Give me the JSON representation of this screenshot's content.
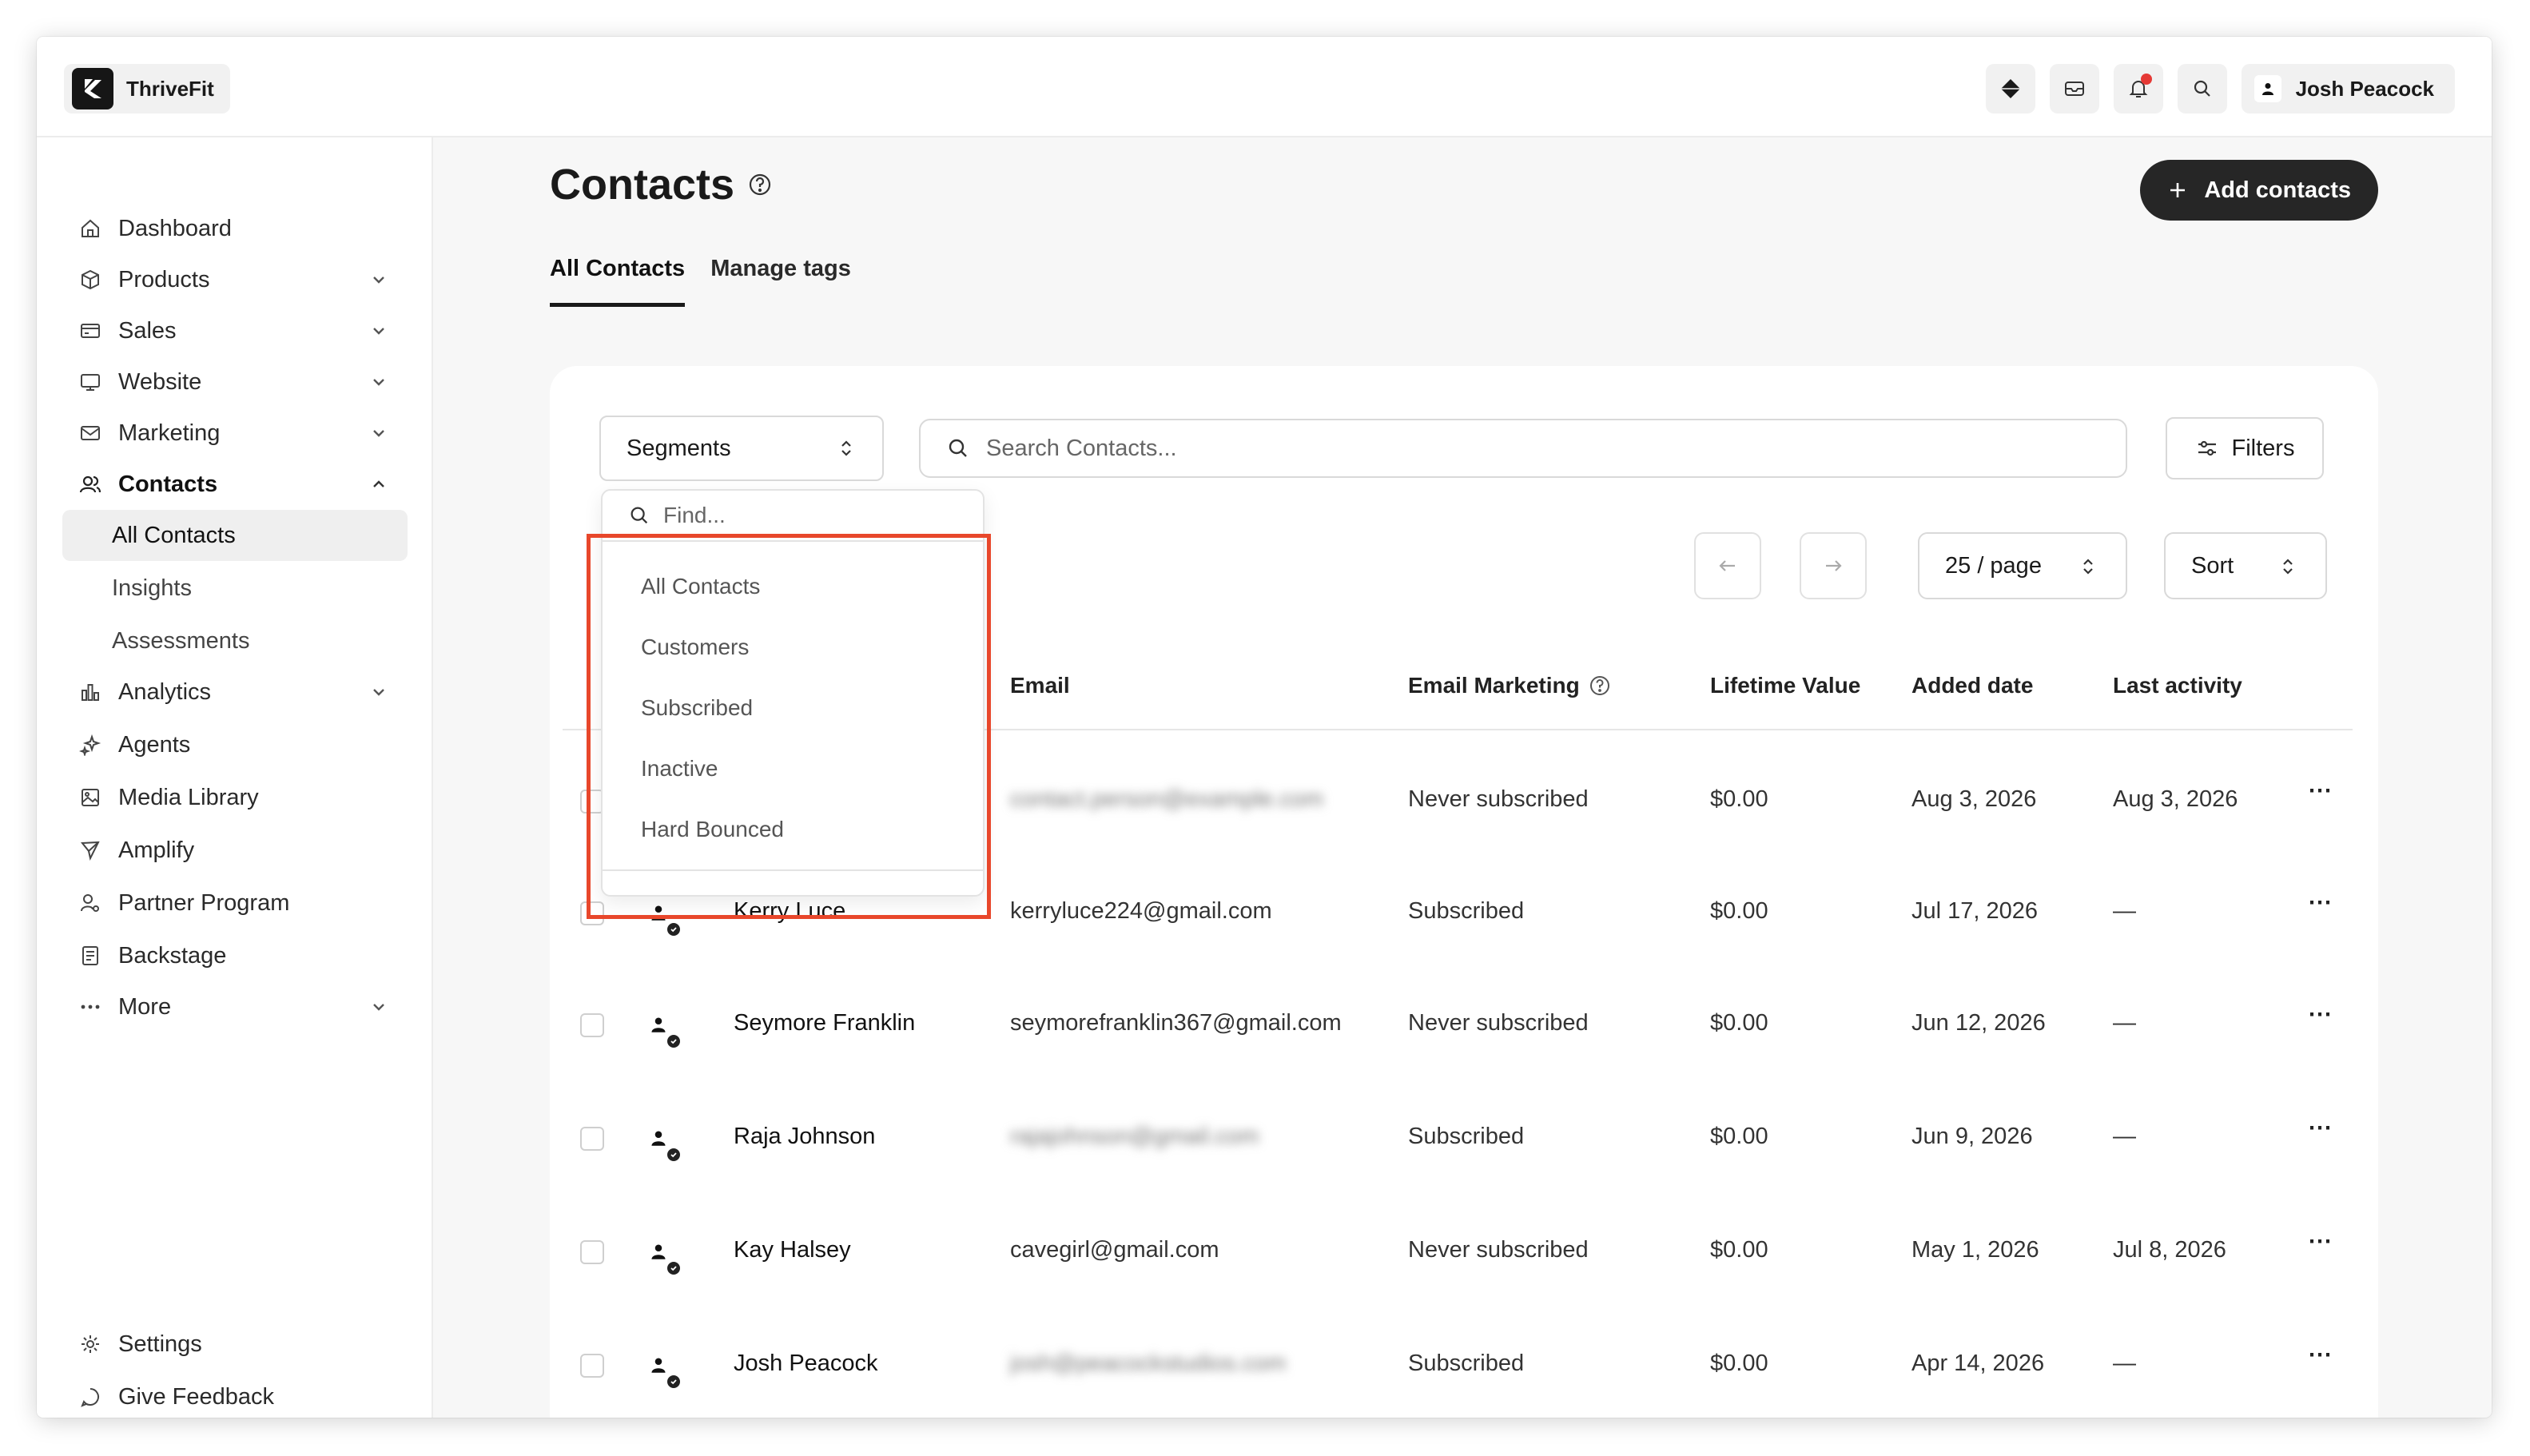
{
  "app": {
    "name": "ThriveFit"
  },
  "user": {
    "name": "Josh Peacock"
  },
  "topbar_icons": [
    "diamond-icon",
    "inbox-icon",
    "bell-icon",
    "search-icon"
  ],
  "sidebar": {
    "items": [
      {
        "label": "Dashboard",
        "icon": "home-icon"
      },
      {
        "label": "Products",
        "icon": "box-icon"
      },
      {
        "label": "Sales",
        "icon": "card-icon"
      },
      {
        "label": "Website",
        "icon": "monitor-icon"
      },
      {
        "label": "Marketing",
        "icon": "mail-icon"
      },
      {
        "label": "Contacts",
        "icon": "users-icon"
      },
      {
        "label": "All Contacts"
      },
      {
        "label": "Insights"
      },
      {
        "label": "Assessments"
      },
      {
        "label": "Analytics",
        "icon": "chart-icon"
      },
      {
        "label": "Agents",
        "icon": "sparkle-icon"
      },
      {
        "label": "Media Library",
        "icon": "image-icon"
      },
      {
        "label": "Amplify",
        "icon": "send-icon"
      },
      {
        "label": "Partner Program",
        "icon": "partner-icon"
      },
      {
        "label": "Backstage",
        "icon": "doc-icon"
      },
      {
        "label": "More",
        "icon": "dots-icon"
      }
    ],
    "bottom": [
      {
        "label": "Settings",
        "icon": "gear-icon"
      },
      {
        "label": "Give Feedback",
        "icon": "chat-icon"
      }
    ]
  },
  "page": {
    "title": "Contacts",
    "add_button": "Add contacts",
    "tabs": [
      {
        "label": "All Contacts"
      },
      {
        "label": "Manage tags"
      }
    ]
  },
  "toolbar": {
    "segments_label": "Segments",
    "search_placeholder": "Search Contacts...",
    "filters_label": "Filters",
    "per_page": "25 / page",
    "sort_label": "Sort"
  },
  "segments_dropdown": {
    "find_placeholder": "Find...",
    "options": [
      "All Contacts",
      "Customers",
      "Subscribed",
      "Inactive",
      "Hard Bounced"
    ]
  },
  "table": {
    "headers": {
      "email": "Email",
      "email_marketing": "Email Marketing",
      "lifetime_value": "Lifetime Value",
      "added_date": "Added date",
      "last_activity": "Last activity"
    },
    "rows": [
      {
        "name": "",
        "email": "contact.person@example.com",
        "email_blurred": true,
        "marketing": "Never subscribed",
        "ltv": "$0.00",
        "added": "Aug 3, 2026",
        "last": "Aug 3, 2026"
      },
      {
        "name": "Kerry Luce",
        "email": "kerryluce224@gmail.com",
        "email_blurred": false,
        "marketing": "Subscribed",
        "ltv": "$0.00",
        "added": "Jul 17, 2026",
        "last": "—"
      },
      {
        "name": "Seymore Franklin",
        "email": "seymorefranklin367@gmail.com",
        "email_blurred": false,
        "marketing": "Never subscribed",
        "ltv": "$0.00",
        "added": "Jun 12, 2026",
        "last": "—"
      },
      {
        "name": "Raja Johnson",
        "email": "rajajohnson@gmail.com",
        "email_blurred": true,
        "marketing": "Subscribed",
        "ltv": "$0.00",
        "added": "Jun 9, 2026",
        "last": "—"
      },
      {
        "name": "Kay Halsey",
        "email": "cavegirl@gmail.com",
        "email_blurred": false,
        "marketing": "Never subscribed",
        "ltv": "$0.00",
        "added": "May 1, 2026",
        "last": "Jul 8, 2026"
      },
      {
        "name": "Josh Peacock",
        "email": "josh@peacockstudios.com",
        "email_blurred": true,
        "marketing": "Subscribed",
        "ltv": "$0.00",
        "added": "Apr 14, 2026",
        "last": "—"
      }
    ],
    "row_menu": "⋯"
  },
  "colors": {
    "accent_dark": "#262626",
    "highlight": "#e8472b",
    "notification": "#e53935"
  }
}
